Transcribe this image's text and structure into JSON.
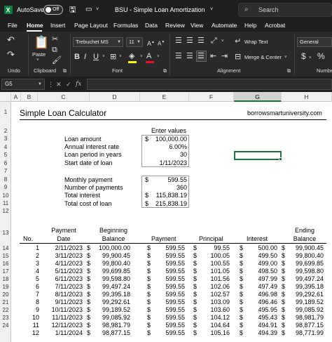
{
  "titlebar": {
    "autosave_label": "AutoSave",
    "autosave_state": "Off",
    "filename": "BSU - Simple Loan Amortization",
    "chevron": "˅",
    "search_placeholder": "Search"
  },
  "menu": {
    "items": [
      "File",
      "Home",
      "Insert",
      "Page Layout",
      "Formulas",
      "Data",
      "Review",
      "View",
      "Automate",
      "Help",
      "Acrobat"
    ],
    "active": "Home"
  },
  "ribbon": {
    "groups": [
      "Undo",
      "Clipboard",
      "Font",
      "Alignment",
      "Numbe"
    ],
    "paste_label": "Paste",
    "font_name": "Trebuchet MS",
    "font_size": "11",
    "wrap_text": "Wrap Text",
    "merge_center": "Merge & Center",
    "number_format": "General",
    "currency_symbol": "$",
    "percent_symbol": "%"
  },
  "formula_bar": {
    "name_box": "G5",
    "fx": "fx"
  },
  "columns": [
    "A",
    "B",
    "C",
    "D",
    "E",
    "F",
    "G",
    "H"
  ],
  "selected_column": "G",
  "rows": [
    "1",
    "2",
    "3",
    "4",
    "5",
    "6",
    "7",
    "8",
    "9",
    "10",
    "11",
    "12",
    "13",
    "14",
    "15",
    "16",
    "17",
    "18",
    "19",
    "20",
    "21",
    "22",
    "23",
    "24"
  ],
  "sheet": {
    "title": "Simple Loan Calculator",
    "website": "borrowsmartuniversity.com",
    "enter_values": "Enter values",
    "inputs": [
      {
        "label": "Loan amount",
        "prefix": "$",
        "value": "100,000.00"
      },
      {
        "label": "Annual interest rate",
        "prefix": "",
        "value": "6.00%"
      },
      {
        "label": "Loan period in years",
        "prefix": "",
        "value": "30"
      },
      {
        "label": "Start date of loan",
        "prefix": "",
        "value": "1/11/2023"
      }
    ],
    "outputs": [
      {
        "label": "Monthly payment",
        "prefix": "$",
        "value": "599.55"
      },
      {
        "label": "Number of payments",
        "prefix": "",
        "value": "360"
      },
      {
        "label": "Total interest",
        "prefix": "$",
        "value": "115,838.19"
      },
      {
        "label": "Total cost of loan",
        "prefix": "$",
        "value": "215,838.19"
      }
    ],
    "table_headers_top": {
      "payment": "Payment",
      "beginning": "Beginning",
      "ending": "Ending"
    },
    "table_headers": {
      "no": "No.",
      "date": "Date",
      "balance": "Balance",
      "payment": "Payment",
      "principal": "Principal",
      "interest": "Interest",
      "ending_balance": "Balance"
    },
    "currency": "$",
    "schedule": [
      {
        "no": "1",
        "date": "2/11/2023",
        "beginning": "100,000.00",
        "payment": "599.55",
        "principal": "99.55",
        "interest": "500.00",
        "ending": "99,900.45"
      },
      {
        "no": "2",
        "date": "3/11/2023",
        "beginning": "99,900.45",
        "payment": "599.55",
        "principal": "100.05",
        "interest": "499.50",
        "ending": "99,800.40"
      },
      {
        "no": "3",
        "date": "4/11/2023",
        "beginning": "99,800.40",
        "payment": "599.55",
        "principal": "100.55",
        "interest": "499.00",
        "ending": "99,699.85"
      },
      {
        "no": "4",
        "date": "5/11/2023",
        "beginning": "99,699.85",
        "payment": "599.55",
        "principal": "101.05",
        "interest": "498.50",
        "ending": "99,598.80"
      },
      {
        "no": "5",
        "date": "6/11/2023",
        "beginning": "99,598.80",
        "payment": "599.55",
        "principal": "101.56",
        "interest": "497.99",
        "ending": "99,497.24"
      },
      {
        "no": "6",
        "date": "7/11/2023",
        "beginning": "99,497.24",
        "payment": "599.55",
        "principal": "102.06",
        "interest": "497.49",
        "ending": "99,395.18"
      },
      {
        "no": "7",
        "date": "8/11/2023",
        "beginning": "99,395.18",
        "payment": "599.55",
        "principal": "102.57",
        "interest": "496.98",
        "ending": "99,292.61"
      },
      {
        "no": "8",
        "date": "9/11/2023",
        "beginning": "99,292.61",
        "payment": "599.55",
        "principal": "103.09",
        "interest": "496.46",
        "ending": "99,189.52"
      },
      {
        "no": "9",
        "date": "10/11/2023",
        "beginning": "99,189.52",
        "payment": "599.55",
        "principal": "103.60",
        "interest": "495.95",
        "ending": "99,085.92"
      },
      {
        "no": "10",
        "date": "11/11/2023",
        "beginning": "99,085.92",
        "payment": "599.55",
        "principal": "104.12",
        "interest": "495.43",
        "ending": "98,981.79"
      },
      {
        "no": "11",
        "date": "12/11/2023",
        "beginning": "98,981.79",
        "payment": "599.55",
        "principal": "104.64",
        "interest": "494.91",
        "ending": "98,877.15"
      },
      {
        "no": "12",
        "date": "1/11/2024",
        "beginning": "98,877.15",
        "payment": "599.55",
        "principal": "105.16",
        "interest": "494.39",
        "ending": "98,771.99"
      }
    ]
  }
}
